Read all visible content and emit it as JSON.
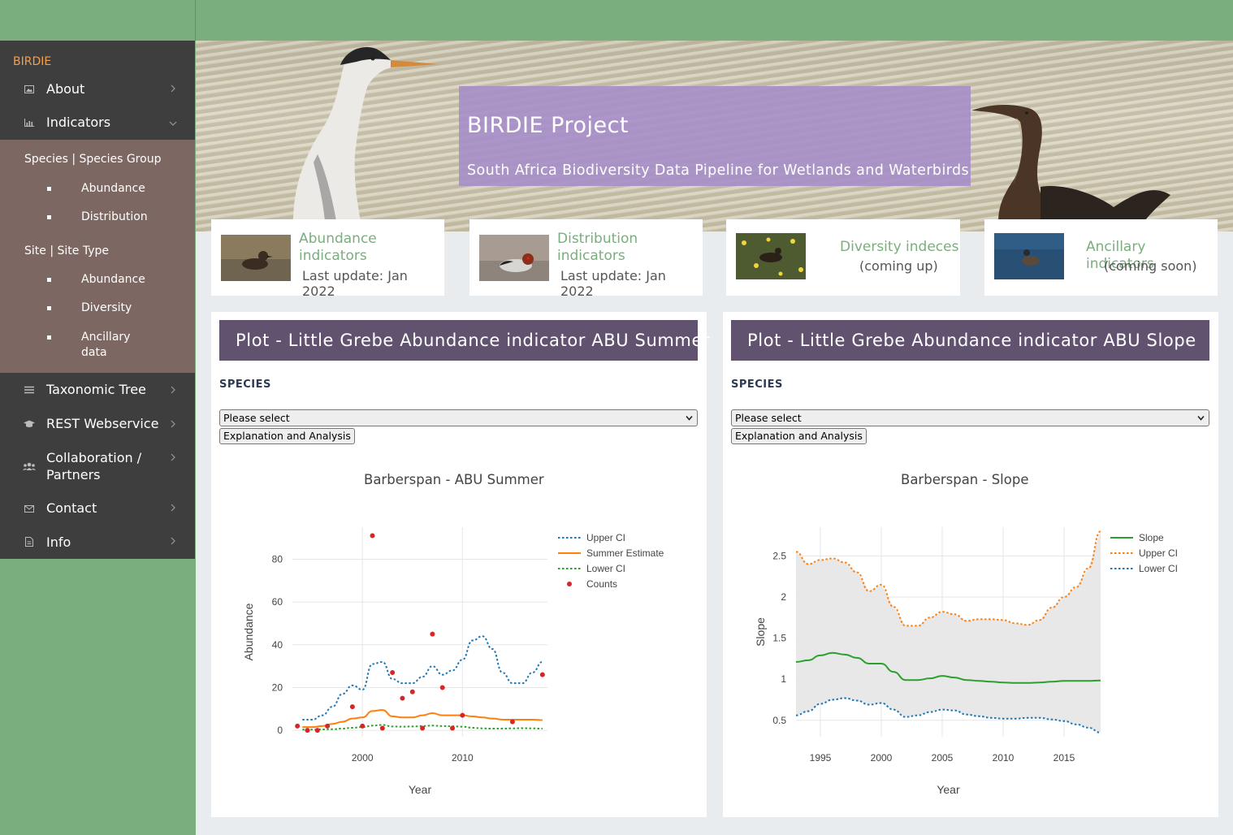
{
  "sidebar": {
    "brand": "BIRDIE",
    "items": [
      {
        "label": "About",
        "icon": "image-icon"
      },
      {
        "label": "Indicators",
        "icon": "chart-icon"
      },
      {
        "label": "Taxonomic Tree",
        "icon": "list-icon"
      },
      {
        "label": "REST Webservice",
        "icon": "graduation-cap-icon"
      },
      {
        "label": "Collaboration /",
        "label2": "Partners",
        "icon": "users-icon"
      },
      {
        "label": "Contact",
        "icon": "envelope-icon"
      },
      {
        "label": "Info",
        "icon": "file-icon"
      }
    ],
    "submenu": {
      "group1": "Species | Species Group",
      "group1_items": [
        "Abundance",
        "Distribution"
      ],
      "group2": "Site | Site Type",
      "group2_items": [
        "Abundance",
        "Diversity",
        "Ancillary",
        "data"
      ]
    }
  },
  "hero": {
    "title": "BIRDIE Project",
    "subtitle": "South Africa Biodiversity Data Pipeline for Wetlands and Waterbirds"
  },
  "cards": [
    {
      "title1": "Abundance",
      "title2": "indicators",
      "sub": "Last update: Jan 2022"
    },
    {
      "title1": "Distribution",
      "title2": "indicators",
      "sub": "Last update: Jan 2022"
    },
    {
      "title1": "Diversity indeces",
      "sub": "(coming up)"
    },
    {
      "title1": "Ancillary indicators",
      "sub": "(coming soon)"
    }
  ],
  "panels": [
    {
      "head_prefix": "Plot - Little Grebe ",
      "head_bold": "Abundance indicator ABU Summer",
      "species_label": "SPECIES",
      "select_value": "Please select",
      "button": "Explanation and Analysis"
    },
    {
      "head_prefix": "Plot - Little Grebe ",
      "head_bold": "Abundance indicator ABU Slope",
      "species_label": "SPECIES",
      "select_value": "Please select",
      "button": "Explanation and Analysis"
    }
  ],
  "colors": {
    "green": "#7aae7e",
    "sidebar": "#3e3e3e",
    "submenu": "#7d6762",
    "panel_head": "#615370",
    "hero_box": "#a58cc8"
  },
  "chart_data": [
    {
      "type": "line",
      "title": "Barberspan - ABU Summer",
      "xlabel": "Year",
      "ylabel": "Abundance",
      "xlim": [
        1993,
        2018.5
      ],
      "ylim": [
        -3,
        95
      ],
      "xticks": [
        2000,
        2010
      ],
      "yticks": [
        0,
        20,
        40,
        60,
        80
      ],
      "grid": true,
      "legend": "top-right",
      "series": [
        {
          "name": "Upper CI",
          "style": "dotted",
          "color": "#1f77b4",
          "x": [
            1994,
            1995,
            1996,
            1997,
            1998,
            1999,
            2000,
            2001,
            2002,
            2003,
            2004,
            2005,
            2006,
            2007,
            2008,
            2009,
            2010,
            2011,
            2012,
            2013,
            2014,
            2015,
            2016,
            2017,
            2018
          ],
          "y": [
            5,
            5,
            7,
            11,
            17,
            21,
            19,
            31,
            32,
            24,
            22,
            22,
            25,
            30,
            26,
            28,
            33,
            42,
            44,
            38,
            27,
            22,
            22,
            27,
            32
          ]
        },
        {
          "name": "Summer Estimate",
          "style": "solid",
          "color": "#ff7f0e",
          "x": [
            1994,
            1995,
            1996,
            1997,
            1998,
            1999,
            2000,
            2001,
            2002,
            2003,
            2004,
            2005,
            2006,
            2007,
            2008,
            2009,
            2010,
            2011,
            2012,
            2013,
            2014,
            2015,
            2016,
            2017,
            2018
          ],
          "y": [
            1.5,
            1.5,
            2,
            3,
            4,
            5.5,
            6,
            9,
            9.5,
            6.5,
            6,
            6,
            7,
            8,
            7,
            7,
            7,
            6.5,
            6,
            5.5,
            5,
            5,
            5,
            5,
            4.8
          ]
        },
        {
          "name": "Lower CI",
          "style": "dotted",
          "color": "#2ca02c",
          "x": [
            1994,
            1995,
            1996,
            1997,
            1998,
            1999,
            2000,
            2001,
            2002,
            2003,
            2004,
            2005,
            2006,
            2007,
            2008,
            2009,
            2010,
            2011,
            2012,
            2013,
            2014,
            2015,
            2016,
            2017,
            2018
          ],
          "y": [
            0.3,
            0.3,
            0.4,
            0.5,
            0.8,
            1.2,
            1.5,
            2.2,
            2.5,
            1.8,
            1.7,
            1.8,
            2,
            2.2,
            2,
            1.9,
            1.7,
            1.2,
            0.9,
            0.8,
            0.8,
            0.9,
            1,
            0.9,
            0.8
          ]
        },
        {
          "name": "Counts",
          "style": "markers",
          "color": "#d62728",
          "x": [
            1993.5,
            1994.5,
            1995.5,
            1996.5,
            1999,
            2000,
            2001,
            2002,
            2003,
            2004,
            2005,
            2006,
            2007,
            2008,
            2009,
            2010,
            2015,
            2018
          ],
          "y": [
            2,
            0,
            0,
            2,
            11,
            2,
            91,
            1,
            27,
            15,
            18,
            1,
            45,
            20,
            1,
            7,
            4,
            26
          ]
        }
      ]
    },
    {
      "type": "line",
      "title": "Barberspan - Slope",
      "xlabel": "Year",
      "ylabel": "Slope",
      "xlim": [
        1993,
        2018
      ],
      "ylim": [
        0.3,
        2.85
      ],
      "xticks": [
        1995,
        2000,
        2005,
        2010,
        2015
      ],
      "yticks": [
        0.5,
        1,
        1.5,
        2,
        2.5
      ],
      "ytick_labels": [
        "0.5",
        "1",
        "1.5",
        "2",
        "2.5"
      ],
      "grid": true,
      "legend": "top-right",
      "series": [
        {
          "name": "Slope",
          "style": "solid",
          "color": "#2ca02c",
          "x": [
            1993,
            1994,
            1995,
            1996,
            1997,
            1998,
            1999,
            2000,
            2001,
            2002,
            2003,
            2004,
            2005,
            2006,
            2007,
            2008,
            2009,
            2010,
            2011,
            2012,
            2013,
            2014,
            2015,
            2016,
            2017,
            2018
          ],
          "y": [
            1.21,
            1.23,
            1.29,
            1.32,
            1.3,
            1.26,
            1.19,
            1.19,
            1.09,
            0.99,
            0.99,
            1.01,
            1.04,
            1.02,
            0.99,
            0.98,
            0.97,
            0.96,
            0.955,
            0.955,
            0.96,
            0.97,
            0.98,
            0.98,
            0.98,
            0.985
          ]
        },
        {
          "name": "Upper CI",
          "style": "dotted",
          "color": "#ff7f0e",
          "x": [
            1993,
            1994,
            1995,
            1996,
            1997,
            1998,
            1999,
            2000,
            2001,
            2002,
            2003,
            2004,
            2005,
            2006,
            2007,
            2008,
            2009,
            2010,
            2011,
            2012,
            2013,
            2014,
            2015,
            2016,
            2017,
            2018
          ],
          "y": [
            2.55,
            2.4,
            2.45,
            2.47,
            2.42,
            2.3,
            2.07,
            2.15,
            1.88,
            1.65,
            1.65,
            1.75,
            1.82,
            1.79,
            1.71,
            1.73,
            1.73,
            1.72,
            1.68,
            1.66,
            1.72,
            1.87,
            2.0,
            2.12,
            2.35,
            2.8
          ]
        },
        {
          "name": "Lower CI",
          "style": "dotted",
          "color": "#1f77b4",
          "x": [
            1993,
            1994,
            1995,
            1996,
            1997,
            1998,
            1999,
            2000,
            2001,
            2002,
            2003,
            2004,
            2005,
            2006,
            2007,
            2008,
            2009,
            2010,
            2011,
            2012,
            2013,
            2014,
            2015,
            2016,
            2017,
            2018
          ],
          "y": [
            0.56,
            0.61,
            0.7,
            0.75,
            0.77,
            0.74,
            0.69,
            0.71,
            0.63,
            0.54,
            0.56,
            0.6,
            0.63,
            0.62,
            0.57,
            0.55,
            0.53,
            0.52,
            0.52,
            0.53,
            0.53,
            0.51,
            0.49,
            0.45,
            0.41,
            0.35
          ]
        }
      ]
    }
  ]
}
